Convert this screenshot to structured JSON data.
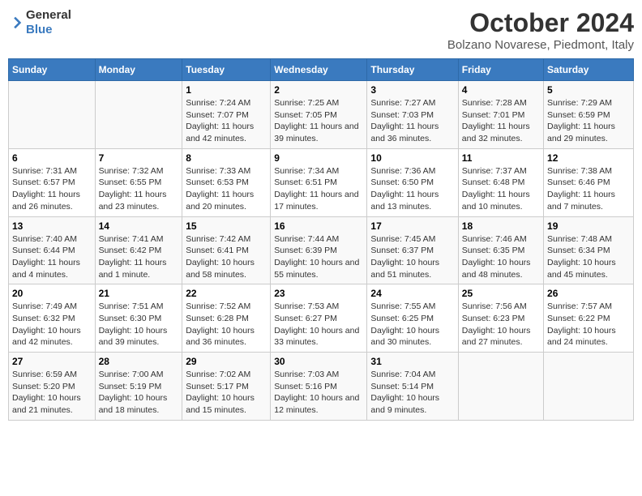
{
  "logo": {
    "general": "General",
    "blue": "Blue"
  },
  "title": "October 2024",
  "subtitle": "Bolzano Novarese, Piedmont, Italy",
  "days_of_week": [
    "Sunday",
    "Monday",
    "Tuesday",
    "Wednesday",
    "Thursday",
    "Friday",
    "Saturday"
  ],
  "weeks": [
    [
      {
        "day": "",
        "sunrise": "",
        "sunset": "",
        "daylight": ""
      },
      {
        "day": "",
        "sunrise": "",
        "sunset": "",
        "daylight": ""
      },
      {
        "day": "1",
        "sunrise": "Sunrise: 7:24 AM",
        "sunset": "Sunset: 7:07 PM",
        "daylight": "Daylight: 11 hours and 42 minutes."
      },
      {
        "day": "2",
        "sunrise": "Sunrise: 7:25 AM",
        "sunset": "Sunset: 7:05 PM",
        "daylight": "Daylight: 11 hours and 39 minutes."
      },
      {
        "day": "3",
        "sunrise": "Sunrise: 7:27 AM",
        "sunset": "Sunset: 7:03 PM",
        "daylight": "Daylight: 11 hours and 36 minutes."
      },
      {
        "day": "4",
        "sunrise": "Sunrise: 7:28 AM",
        "sunset": "Sunset: 7:01 PM",
        "daylight": "Daylight: 11 hours and 32 minutes."
      },
      {
        "day": "5",
        "sunrise": "Sunrise: 7:29 AM",
        "sunset": "Sunset: 6:59 PM",
        "daylight": "Daylight: 11 hours and 29 minutes."
      }
    ],
    [
      {
        "day": "6",
        "sunrise": "Sunrise: 7:31 AM",
        "sunset": "Sunset: 6:57 PM",
        "daylight": "Daylight: 11 hours and 26 minutes."
      },
      {
        "day": "7",
        "sunrise": "Sunrise: 7:32 AM",
        "sunset": "Sunset: 6:55 PM",
        "daylight": "Daylight: 11 hours and 23 minutes."
      },
      {
        "day": "8",
        "sunrise": "Sunrise: 7:33 AM",
        "sunset": "Sunset: 6:53 PM",
        "daylight": "Daylight: 11 hours and 20 minutes."
      },
      {
        "day": "9",
        "sunrise": "Sunrise: 7:34 AM",
        "sunset": "Sunset: 6:51 PM",
        "daylight": "Daylight: 11 hours and 17 minutes."
      },
      {
        "day": "10",
        "sunrise": "Sunrise: 7:36 AM",
        "sunset": "Sunset: 6:50 PM",
        "daylight": "Daylight: 11 hours and 13 minutes."
      },
      {
        "day": "11",
        "sunrise": "Sunrise: 7:37 AM",
        "sunset": "Sunset: 6:48 PM",
        "daylight": "Daylight: 11 hours and 10 minutes."
      },
      {
        "day": "12",
        "sunrise": "Sunrise: 7:38 AM",
        "sunset": "Sunset: 6:46 PM",
        "daylight": "Daylight: 11 hours and 7 minutes."
      }
    ],
    [
      {
        "day": "13",
        "sunrise": "Sunrise: 7:40 AM",
        "sunset": "Sunset: 6:44 PM",
        "daylight": "Daylight: 11 hours and 4 minutes."
      },
      {
        "day": "14",
        "sunrise": "Sunrise: 7:41 AM",
        "sunset": "Sunset: 6:42 PM",
        "daylight": "Daylight: 11 hours and 1 minute."
      },
      {
        "day": "15",
        "sunrise": "Sunrise: 7:42 AM",
        "sunset": "Sunset: 6:41 PM",
        "daylight": "Daylight: 10 hours and 58 minutes."
      },
      {
        "day": "16",
        "sunrise": "Sunrise: 7:44 AM",
        "sunset": "Sunset: 6:39 PM",
        "daylight": "Daylight: 10 hours and 55 minutes."
      },
      {
        "day": "17",
        "sunrise": "Sunrise: 7:45 AM",
        "sunset": "Sunset: 6:37 PM",
        "daylight": "Daylight: 10 hours and 51 minutes."
      },
      {
        "day": "18",
        "sunrise": "Sunrise: 7:46 AM",
        "sunset": "Sunset: 6:35 PM",
        "daylight": "Daylight: 10 hours and 48 minutes."
      },
      {
        "day": "19",
        "sunrise": "Sunrise: 7:48 AM",
        "sunset": "Sunset: 6:34 PM",
        "daylight": "Daylight: 10 hours and 45 minutes."
      }
    ],
    [
      {
        "day": "20",
        "sunrise": "Sunrise: 7:49 AM",
        "sunset": "Sunset: 6:32 PM",
        "daylight": "Daylight: 10 hours and 42 minutes."
      },
      {
        "day": "21",
        "sunrise": "Sunrise: 7:51 AM",
        "sunset": "Sunset: 6:30 PM",
        "daylight": "Daylight: 10 hours and 39 minutes."
      },
      {
        "day": "22",
        "sunrise": "Sunrise: 7:52 AM",
        "sunset": "Sunset: 6:28 PM",
        "daylight": "Daylight: 10 hours and 36 minutes."
      },
      {
        "day": "23",
        "sunrise": "Sunrise: 7:53 AM",
        "sunset": "Sunset: 6:27 PM",
        "daylight": "Daylight: 10 hours and 33 minutes."
      },
      {
        "day": "24",
        "sunrise": "Sunrise: 7:55 AM",
        "sunset": "Sunset: 6:25 PM",
        "daylight": "Daylight: 10 hours and 30 minutes."
      },
      {
        "day": "25",
        "sunrise": "Sunrise: 7:56 AM",
        "sunset": "Sunset: 6:23 PM",
        "daylight": "Daylight: 10 hours and 27 minutes."
      },
      {
        "day": "26",
        "sunrise": "Sunrise: 7:57 AM",
        "sunset": "Sunset: 6:22 PM",
        "daylight": "Daylight: 10 hours and 24 minutes."
      }
    ],
    [
      {
        "day": "27",
        "sunrise": "Sunrise: 6:59 AM",
        "sunset": "Sunset: 5:20 PM",
        "daylight": "Daylight: 10 hours and 21 minutes."
      },
      {
        "day": "28",
        "sunrise": "Sunrise: 7:00 AM",
        "sunset": "Sunset: 5:19 PM",
        "daylight": "Daylight: 10 hours and 18 minutes."
      },
      {
        "day": "29",
        "sunrise": "Sunrise: 7:02 AM",
        "sunset": "Sunset: 5:17 PM",
        "daylight": "Daylight: 10 hours and 15 minutes."
      },
      {
        "day": "30",
        "sunrise": "Sunrise: 7:03 AM",
        "sunset": "Sunset: 5:16 PM",
        "daylight": "Daylight: 10 hours and 12 minutes."
      },
      {
        "day": "31",
        "sunrise": "Sunrise: 7:04 AM",
        "sunset": "Sunset: 5:14 PM",
        "daylight": "Daylight: 10 hours and 9 minutes."
      },
      {
        "day": "",
        "sunrise": "",
        "sunset": "",
        "daylight": ""
      },
      {
        "day": "",
        "sunrise": "",
        "sunset": "",
        "daylight": ""
      }
    ]
  ]
}
